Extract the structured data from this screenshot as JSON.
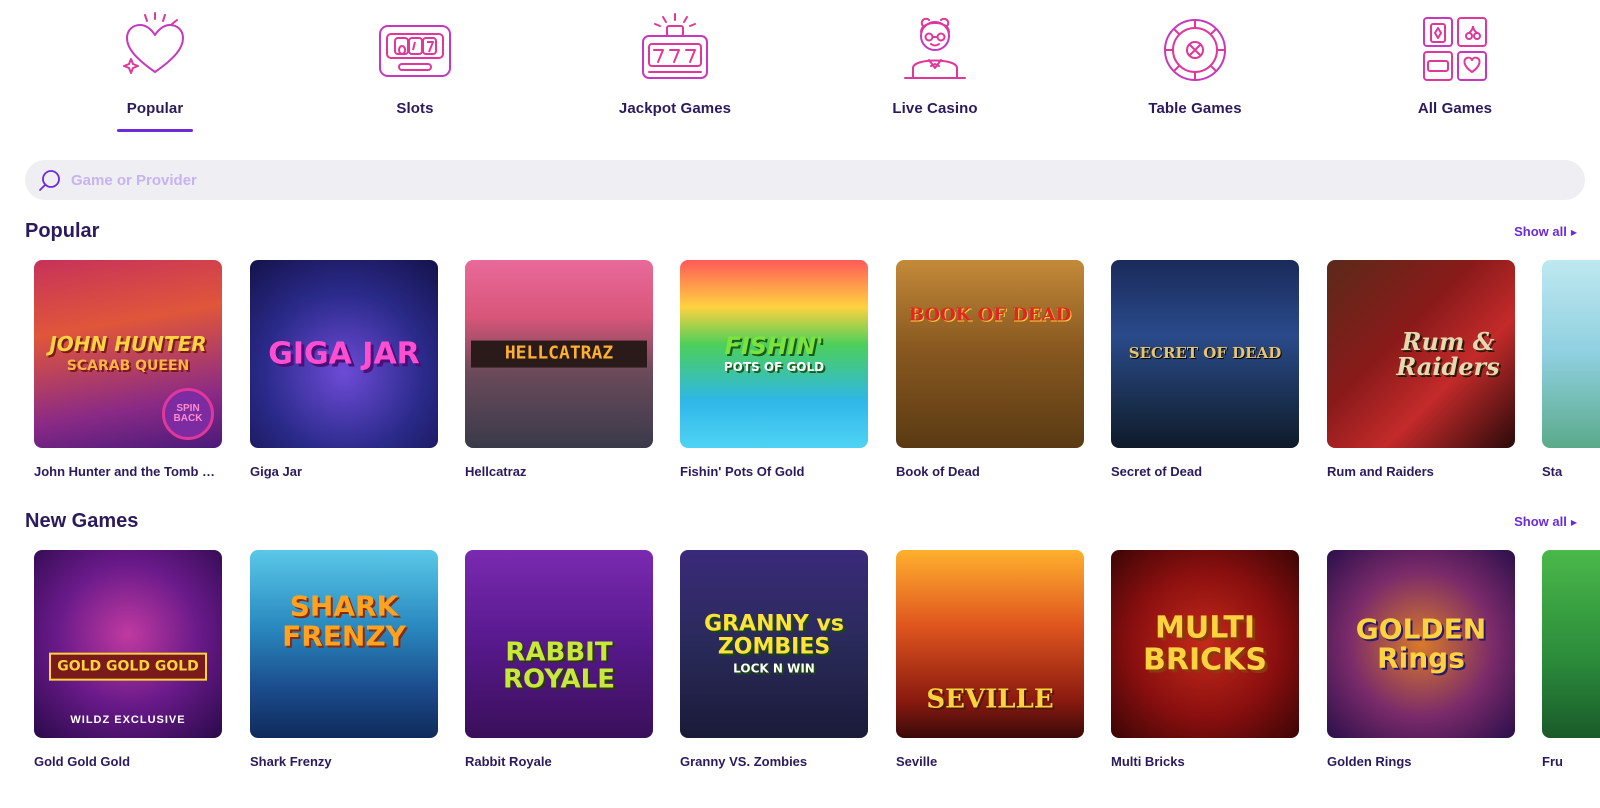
{
  "categories": [
    {
      "label": "Popular",
      "icon": "heart-sparkle-icon",
      "active": true
    },
    {
      "label": "Slots",
      "icon": "slot-machine-icon",
      "active": false
    },
    {
      "label": "Jackpot Games",
      "icon": "jackpot-777-icon",
      "active": false
    },
    {
      "label": "Live Casino",
      "icon": "live-dealer-icon",
      "active": false
    },
    {
      "label": "Table Games",
      "icon": "roulette-wheel-icon",
      "active": false
    },
    {
      "label": "All Games",
      "icon": "game-grid-icon",
      "active": false
    }
  ],
  "search": {
    "placeholder": "Game or Provider",
    "value": ""
  },
  "sections": [
    {
      "title": "Popular",
      "show_all": "Show all",
      "games": [
        {
          "name": "John Hunter and the Tomb of the Scarab Queen",
          "art": "JOHN HUNTER",
          "art_sub": "SCARAB QUEEN",
          "badge": "SPIN BACK"
        },
        {
          "name": "Giga Jar",
          "art": "GIGA JAR"
        },
        {
          "name": "Hellcatraz",
          "art": "HELLCATRAZ"
        },
        {
          "name": "Fishin' Pots Of Gold",
          "art": "FISHIN'",
          "art_sub": "POTS OF GOLD"
        },
        {
          "name": "Book of Dead",
          "art": "BOOK OF DEAD"
        },
        {
          "name": "Secret of Dead",
          "art": "SECRET OF DEAD"
        },
        {
          "name": "Rum and Raiders",
          "art": "Rum & Raiders"
        },
        {
          "name": "Sta",
          "art": ""
        }
      ]
    },
    {
      "title": "New Games",
      "show_all": "Show all",
      "games": [
        {
          "name": "Gold Gold Gold",
          "art": "GOLD GOLD GOLD",
          "tag": "WILDZ EXCLUSIVE"
        },
        {
          "name": "Shark Frenzy",
          "art": "SHARK FRENZY"
        },
        {
          "name": "Rabbit Royale",
          "art": "RABBIT ROYALE"
        },
        {
          "name": "Granny VS. Zombies",
          "art": "GRANNY vs ZOMBIES",
          "art_sub": "LOCK N WIN"
        },
        {
          "name": "Seville",
          "art": "SEVILLE"
        },
        {
          "name": "Multi Bricks",
          "art": "MULTI BRICKS"
        },
        {
          "name": "Golden Rings",
          "art": "GOLDEN Rings"
        },
        {
          "name": "Fru",
          "art": ""
        }
      ]
    }
  ],
  "colors": {
    "accent": "#6b2bd9",
    "icon_pink": "#e0379b",
    "text": "#2b1a5c"
  }
}
